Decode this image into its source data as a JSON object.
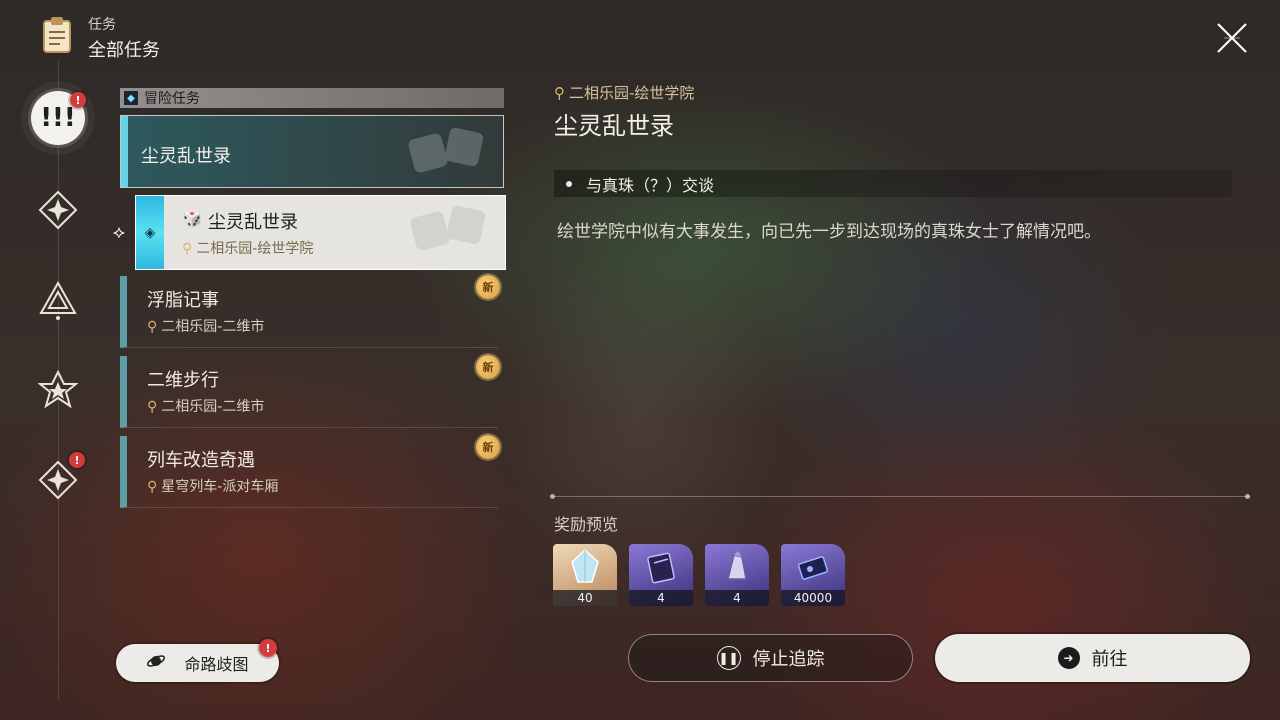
{
  "header": {
    "subtitle": "任务",
    "title": "全部任务",
    "icon": "clipboard-icon",
    "close_icon": "close-x-icon"
  },
  "rail": {
    "items": [
      {
        "name": "adventure-missions",
        "icon": "exclamation-icon",
        "active": true,
        "alert": "!"
      },
      {
        "name": "trailblaze-missions",
        "icon": "diamond-star-icon",
        "active": false
      },
      {
        "name": "companion-missions",
        "icon": "triangle-icon",
        "active": false
      },
      {
        "name": "daily-missions",
        "icon": "star-icon",
        "active": false
      },
      {
        "name": "event-missions",
        "icon": "diamond-star-icon",
        "active": false,
        "alert": "!"
      }
    ]
  },
  "list": {
    "category": "冒险任务",
    "parent": {
      "title": "尘灵乱世录"
    },
    "selected": {
      "title": "尘灵乱世录",
      "location": "二相乐园-绘世学院"
    },
    "quests": [
      {
        "title": "浮脂记事",
        "location": "二相乐园-二维市",
        "badge": "新"
      },
      {
        "title": "二维步行",
        "location": "二相乐园-二维市",
        "badge": "新"
      },
      {
        "title": "列车改造奇遇",
        "location": "星穹列车-派对车厢",
        "badge": "新"
      }
    ],
    "fork_button": {
      "label": "命路歧图",
      "alert": "!"
    }
  },
  "detail": {
    "location": "二相乐园-绘世学院",
    "title": "尘灵乱世录",
    "objective": "与真珠（？）交谈",
    "description": "绘世学院中似有大事发生，向已先一步到达现场的真珠女士了解情况吧。",
    "reward_title": "奖励预览",
    "rewards": [
      {
        "item": "crystal-icon",
        "qty": "40",
        "rarity": "gold"
      },
      {
        "item": "book-icon",
        "qty": "4",
        "rarity": "purple"
      },
      {
        "item": "material-icon",
        "qty": "4",
        "rarity": "purple"
      },
      {
        "item": "credit-icon",
        "qty": "40000",
        "rarity": "purple"
      }
    ],
    "stop_button": "停止追踪",
    "go_button": "前往"
  },
  "colors": {
    "accent_cyan": "#66d3e6",
    "alert_red": "#d63b3b",
    "new_gold": "#d09a3a",
    "location_gold": "#d9b56a"
  }
}
